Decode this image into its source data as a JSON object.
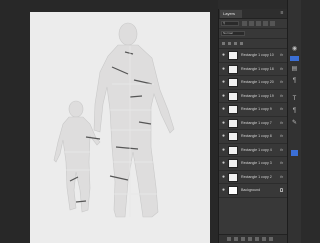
{
  "panel": {
    "tab_label": "Layers",
    "menu_icon": "menu-icon",
    "blend_mode": "Normal"
  },
  "layers": [
    {
      "name": "Rectangle 1 copy 10",
      "effects": "fx",
      "visible": true,
      "selected": false
    },
    {
      "name": "Rectangle 1 copy 18",
      "effects": "fx",
      "visible": true,
      "selected": false
    },
    {
      "name": "Rectangle 1 copy 20",
      "effects": "fx",
      "visible": true,
      "selected": false
    },
    {
      "name": "Rectangle 1 copy 19",
      "effects": "fx",
      "visible": true,
      "selected": false
    },
    {
      "name": "Rectangle 1 copy 9",
      "effects": "fx",
      "visible": true,
      "selected": false
    },
    {
      "name": "Rectangle 1 copy 7",
      "effects": "fx",
      "visible": true,
      "selected": false
    },
    {
      "name": "Rectangle 1 copy 8",
      "effects": "fx",
      "visible": true,
      "selected": false
    },
    {
      "name": "Rectangle 1 copy 4",
      "effects": "fx",
      "visible": true,
      "selected": false
    },
    {
      "name": "Rectangle 1 copy 3",
      "effects": "fx",
      "visible": true,
      "selected": false
    },
    {
      "name": "Rectangle 1 copy 2",
      "effects": "fx",
      "visible": true,
      "selected": false
    }
  ],
  "background_layer": {
    "name": "Background",
    "locked": true,
    "visible": true
  },
  "colors": {
    "canvas_bg": "#282828",
    "document": "#ececec",
    "silhouette": "#dcdcdc",
    "panel_bg": "#383838",
    "accent": "#3b6fd6"
  },
  "dock": {
    "tools": [
      "eye-icon",
      "adjust-icon",
      "type-icon",
      "paragraph-icon",
      "brush-icon"
    ],
    "swatch_color": "#3b6fd6"
  }
}
